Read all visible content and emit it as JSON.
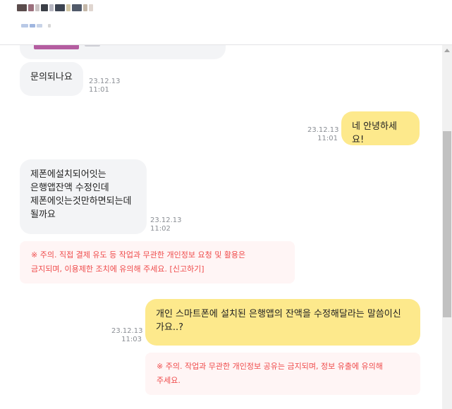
{
  "colors": {
    "sent_bubble": "#fde98c",
    "recv_bubble": "#f3f4f6",
    "warning_text": "#ef4b4b",
    "warning_bg": "#fff5f5"
  },
  "messages": [
    {
      "dir": "recv",
      "text": "문의되나요",
      "date": "23.12.13",
      "time": "11:01"
    },
    {
      "dir": "sent",
      "text": "네 안녕하세요!",
      "date": "23.12.13",
      "time": "11:01"
    },
    {
      "dir": "recv",
      "lines": [
        "제폰에설치되어잇는",
        "은행앱잔액 수정인데",
        "제폰에잇는것만하면되는데",
        "될까요"
      ],
      "date": "23.12.13",
      "time": "11:02"
    },
    {
      "dir": "sent",
      "lines": [
        "개인 스마트폰에 설치된 은행앱의 잔액을 수정해달라는 말씀이신",
        "가요..?"
      ],
      "date": "23.12.13",
      "time": "11:03"
    }
  ],
  "warnings": [
    {
      "line1": "※ 주의. 직접 결제 유도 등 작업과 무관한 개인정보 요청 및 활용은",
      "line2": "금지되며, 이용제한 조치에 유의해 주세요.",
      "link": "[신고하기]"
    },
    {
      "line1": "※ 주의. 작업과 무관한 개인정보 공유는 금지되며, 정보 유출에 유의해",
      "line2": "주세요."
    }
  ]
}
